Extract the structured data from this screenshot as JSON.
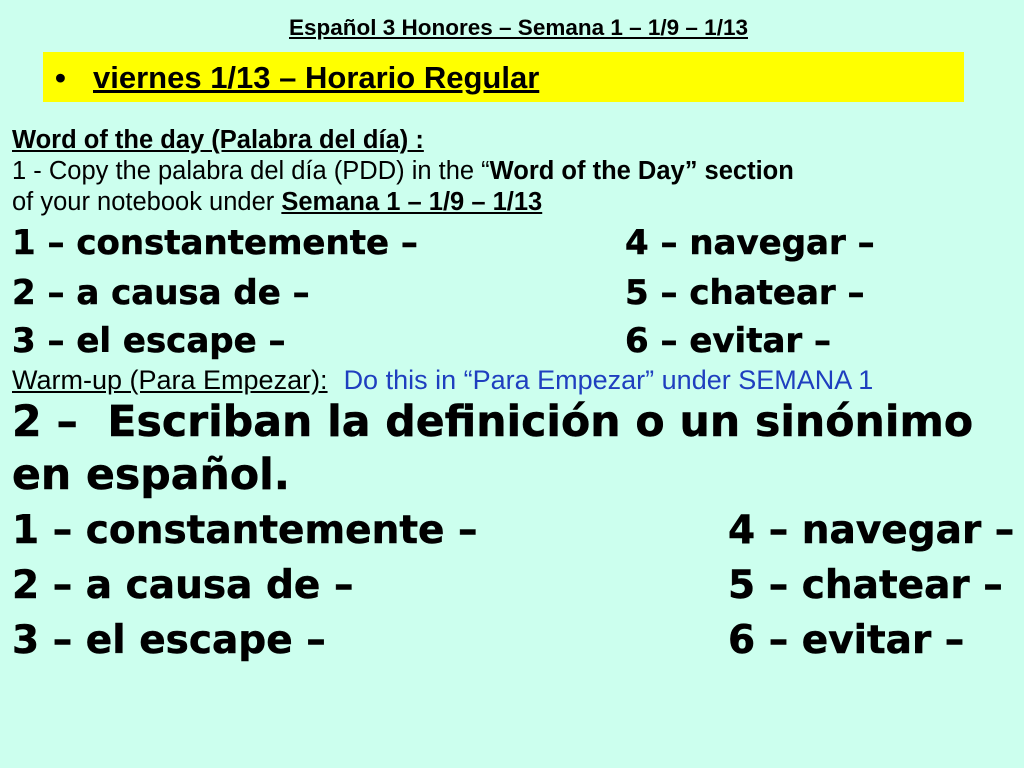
{
  "header": {
    "title": "Español 3 Honores – Semana 1 – 1/9 – 1/13"
  },
  "banner": {
    "bullet": "•",
    "text": "viernes 1/13 – Horario Regular"
  },
  "word_of_day": {
    "heading": "Word of the day (Palabra del día) :",
    "line1_regular": "1 - Copy the palabra del día (PDD) in the “",
    "line1_bold": "Word of the Day” section",
    "line2_regular": "of your notebook under ",
    "line2_bold": "Semana 1 – 1/9 – 1/13",
    "items_left": [
      "1 – constantemente –",
      "2 – a causa de –",
      "3 – el escape –"
    ],
    "items_right": [
      "4 – navegar –",
      "5 – chatear –",
      "6 – evitar –"
    ]
  },
  "warm_up": {
    "label": "Warm-up (Para Empezar):",
    "instruction": "Do this in “Para Empezar” under SEMANA 1",
    "prompt_line1": "2 –  Escriban la definición o un sinónimo",
    "prompt_line2": "en español.",
    "items_left": [
      "1 – constantemente –",
      "2 – a causa de –",
      "3 – el escape –"
    ],
    "items_right": [
      "4 – navegar –",
      "5 – chatear –",
      "6 – evitar –"
    ]
  },
  "colors": {
    "background": "#ccffee",
    "banner": "#ffff00",
    "instruction_blue": "#1f3fbf",
    "text": "#000000"
  }
}
